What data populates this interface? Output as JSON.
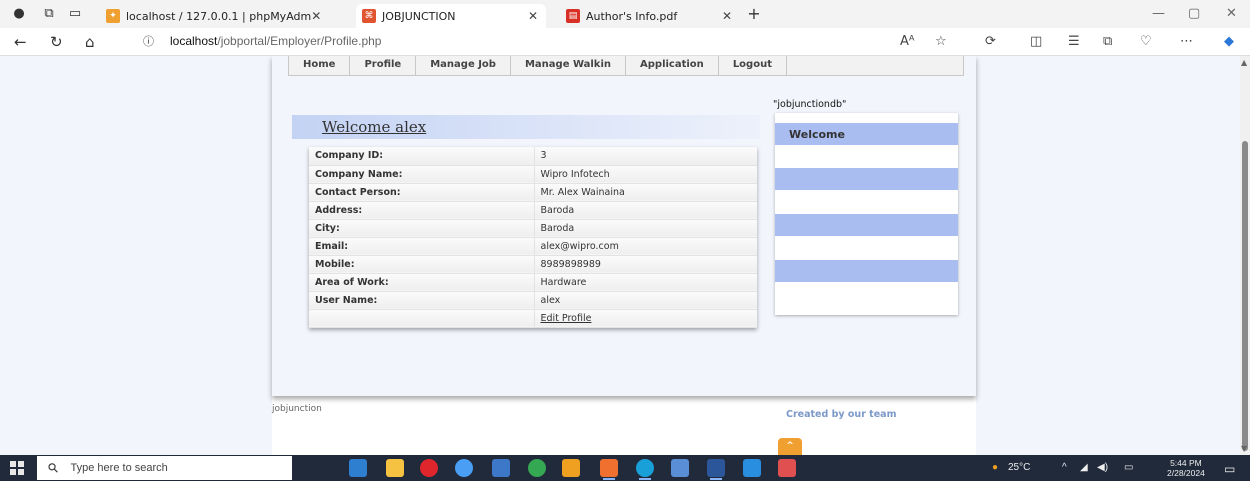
{
  "browser": {
    "tabs": [
      {
        "title": "localhost / 127.0.0.1 | phpMyAdm",
        "active": false
      },
      {
        "title": "JOBJUNCTION",
        "active": true
      },
      {
        "title": "Author's Info.pdf",
        "active": false
      }
    ],
    "new_tab": "+",
    "url_host": "localhost",
    "url_path": "/jobportal/Employer/Profile.php",
    "url_info_icon": "info-icon"
  },
  "page": {
    "menu": [
      "Home",
      "Profile",
      "Manage Job",
      "Manage Walkin",
      "Application",
      "Logout"
    ],
    "welcome": "Welcome alex",
    "db_name": "\"jobjunctiondb\"",
    "side_title": "Welcome",
    "profile": [
      {
        "label": "Company ID:",
        "value": "3"
      },
      {
        "label": "Company Name:",
        "value": "Wipro Infotech"
      },
      {
        "label": "Contact Person:",
        "value": "Mr. Alex Wainaina"
      },
      {
        "label": "Address:",
        "value": "Baroda"
      },
      {
        "label": "City:",
        "value": "Baroda"
      },
      {
        "label": "Email:",
        "value": "alex@wipro.com"
      },
      {
        "label": "Mobile:",
        "value": "8989898989"
      },
      {
        "label": "Area of Work:",
        "value": "Hardware"
      },
      {
        "label": "User Name:",
        "value": "alex"
      }
    ],
    "edit_link": "Edit Profile",
    "footer_left": "jobjunction",
    "footer_right": "Created by our team",
    "to_top": "^"
  },
  "taskbar": {
    "search_placeholder": "Type here to search",
    "weather": "25°C",
    "time": "5:44 PM",
    "date": "2/28/2024"
  },
  "colors": {
    "side_band": "#a9bdf0",
    "to_top": "#f0a030",
    "taskbar": "#202a3a"
  }
}
